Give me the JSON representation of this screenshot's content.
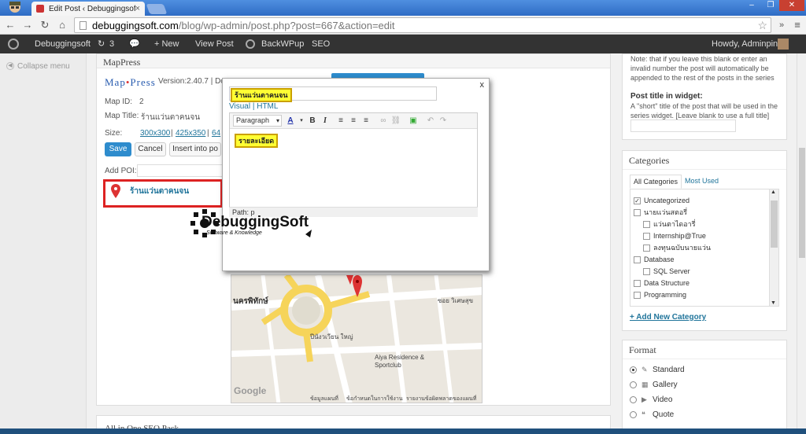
{
  "browser": {
    "tab_title": "Edit Post ‹ Debuggingsoft",
    "url_host": "debuggingsoft.com",
    "url_path": "/blog/wp-admin/post.php?post=667&action=edit"
  },
  "adminbar": {
    "site": "Debuggingsoft",
    "updates": "3",
    "new": "+ New",
    "view_post": "View Post",
    "backwpup": "BackWPup",
    "seo": "SEO",
    "howdy": "Howdy, Adminping"
  },
  "sidebar": {
    "collapse": "Collapse menu"
  },
  "mappress": {
    "box_title": "MapPress",
    "logo_a": "Map",
    "logo_b": "Press",
    "version": "Version:2.40.7 | Do",
    "map_id_label": "Map ID:",
    "map_id_value": "2",
    "map_title_label": "Map Title:",
    "map_title_value": "ร้านแว่นตาคนจน",
    "size_label": "Size:",
    "size1": "300x300",
    "size2": "425x350",
    "size3": "64",
    "save": "Save",
    "cancel": "Cancel",
    "insert": "Insert into po",
    "add_poi_label": "Add POI:",
    "poi_name": "ร้านแว่นตาคนจน",
    "map_labels": {
      "a": "นครพิทักษ์",
      "b": "ซอย วิเศษสุข",
      "c": "ปีนังวเวียน ใหญ่",
      "d": "Aiya Residence & Sportclub",
      "e": "ข้อมูลแผนที่",
      "f": "ข้อกำหนดในการใช้งาน",
      "g": "รายงานข้อผิดพลาดของแผนที่"
    }
  },
  "modal": {
    "close": "x",
    "title_value": "ร้านแว่นตาคนจน",
    "tab_visual": "Visual",
    "tab_html": "HTML",
    "format": "Paragraph",
    "content": "รายละเอียด",
    "path": "Path: p"
  },
  "watermark": {
    "title": "DebuggingSoft",
    "sub": "Software & Knowledge"
  },
  "series": {
    "note": "Note: that if you leave this blank or enter an invalid number the post will automatically be appended to the rest of the posts in the series",
    "widget_label": "Post title in widget:",
    "widget_help": "A \"short\" title of the post that will be used in the series widget. [Leave blank to use a full title]"
  },
  "categories": {
    "title": "Categories",
    "tab_all": "All Categories",
    "tab_used": "Most Used",
    "items": [
      {
        "label": "Uncategorized",
        "checked": true,
        "indent": 0
      },
      {
        "label": "นายแว่นสตอรี่",
        "checked": false,
        "indent": 0
      },
      {
        "label": "แว่นตาไดอารี่",
        "checked": false,
        "indent": 1
      },
      {
        "label": "Internship@True",
        "checked": false,
        "indent": 1
      },
      {
        "label": "ลงทุนฉบับนายแว่น",
        "checked": false,
        "indent": 1
      },
      {
        "label": "Database",
        "checked": false,
        "indent": 0
      },
      {
        "label": "SQL Server",
        "checked": false,
        "indent": 1
      },
      {
        "label": "Data Structure",
        "checked": false,
        "indent": 0
      },
      {
        "label": "Programming",
        "checked": false,
        "indent": 0
      }
    ],
    "add_new": "+ Add New Category"
  },
  "format": {
    "title": "Format",
    "items": [
      {
        "label": "Standard",
        "selected": true,
        "icon": "pin-icon"
      },
      {
        "label": "Gallery",
        "selected": false,
        "icon": "gallery-icon"
      },
      {
        "label": "Video",
        "selected": false,
        "icon": "video-icon"
      },
      {
        "label": "Quote",
        "selected": false,
        "icon": "quote-icon"
      }
    ]
  },
  "seo_box": {
    "title": "All in One SEO Pack"
  }
}
